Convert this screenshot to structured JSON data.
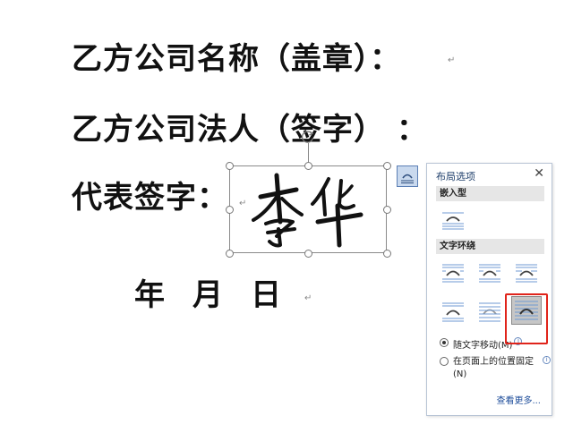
{
  "document": {
    "line1": "乙方公司名称（盖章）：",
    "line2": "乙方公司法人（签字）  ：",
    "line3": "代表签字：",
    "date": {
      "year": "年",
      "month": "月",
      "day": "日"
    },
    "para_mark": "↵"
  },
  "panel": {
    "title": "布局选项",
    "close": "✕",
    "section_inline": "嵌入型",
    "section_wrap": "文字环绕",
    "radio_move": "随文字移动(M)",
    "radio_fix": "在页面上的位置固定(N)",
    "info": "i",
    "see_more": "查看更多..."
  },
  "colors": {
    "accent": "#1f4e9b",
    "highlight": "#e0241b",
    "icon_blue": "#6f9ad3"
  }
}
